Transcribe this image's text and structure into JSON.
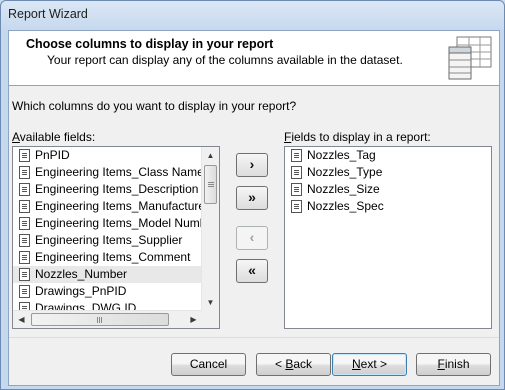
{
  "window": {
    "title": "Report Wizard"
  },
  "header": {
    "title": "Choose columns to display in your report",
    "subtitle": "Your report can display any of the columns available in the dataset.",
    "art_icon": "table-columns-icon"
  },
  "question": "Which columns do you want to display in your report?",
  "available": {
    "label_first": "A",
    "label_rest": "vailable fields:",
    "items": [
      "PnPID",
      "Engineering Items_Class Name",
      "Engineering Items_Description",
      "Engineering Items_Manufacturer",
      "Engineering Items_Model Number",
      "Engineering Items_Supplier",
      "Engineering Items_Comment",
      "Nozzles_Number",
      "Drawings_PnPID",
      "Drawings_DWG ID"
    ]
  },
  "selected": {
    "label_first": "F",
    "label_rest": "ields to display in a report:",
    "items": [
      "Nozzles_Tag",
      "Nozzles_Type",
      "Nozzles_Size",
      "Nozzles_Spec"
    ]
  },
  "move_buttons": {
    "add_one": "›",
    "add_all": "»",
    "remove_one": "‹",
    "remove_all": "«"
  },
  "footer": {
    "cancel": "Cancel",
    "back_pre": "< ",
    "back_u": "B",
    "back_post": "ack",
    "next_u": "N",
    "next_post": "ext >",
    "finish_u": "F",
    "finish_post": "inish"
  }
}
